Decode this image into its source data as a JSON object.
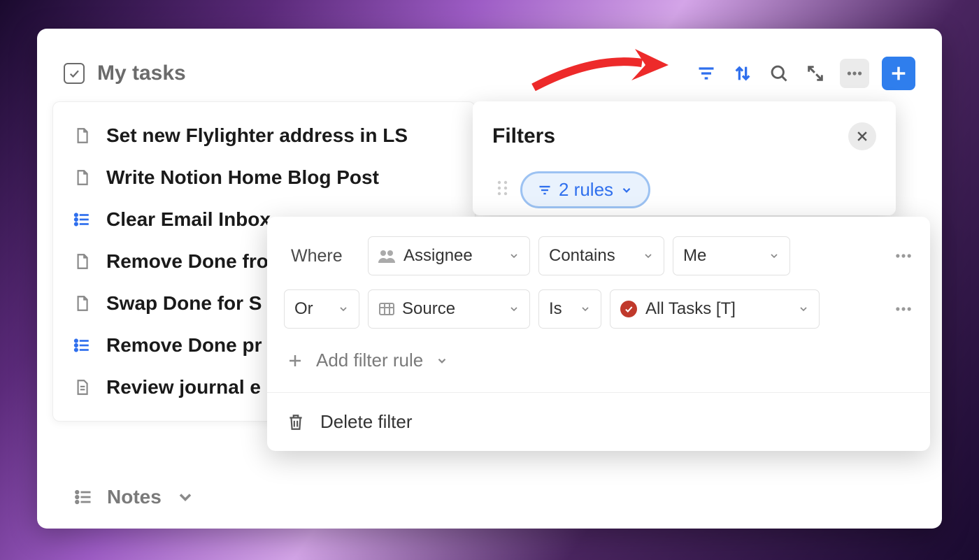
{
  "header": {
    "title": "My tasks"
  },
  "tasks": [
    {
      "label": "Set new Flylighter address in LS",
      "icon": "page"
    },
    {
      "label": "Write Notion Home Blog Post",
      "icon": "page"
    },
    {
      "label": "Clear Email Inbox",
      "icon": "list"
    },
    {
      "label": "Remove Done fro",
      "icon": "page"
    },
    {
      "label": "Swap Done for S",
      "icon": "page"
    },
    {
      "label": "Remove Done pr",
      "icon": "list"
    },
    {
      "label": "Review journal e",
      "icon": "doc"
    }
  ],
  "notes": {
    "label": "Notes"
  },
  "filters": {
    "title": "Filters",
    "pill": "2 rules",
    "rules": {
      "row1": {
        "connector": "Where",
        "property": "Assignee",
        "condition": "Contains",
        "value": "Me"
      },
      "row2": {
        "connector": "Or",
        "property": "Source",
        "condition": "Is",
        "value": "All Tasks [T]"
      }
    },
    "add_rule": "Add filter rule",
    "delete": "Delete filter"
  }
}
